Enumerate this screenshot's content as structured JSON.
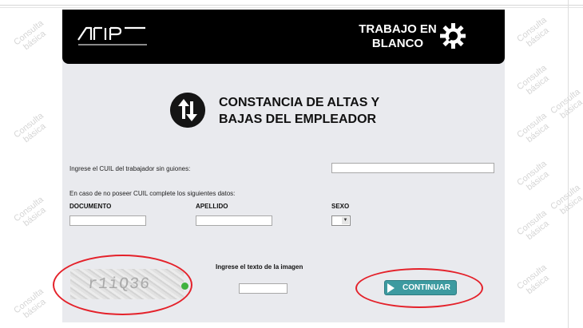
{
  "header": {
    "badge_line1": "TRABAJO EN",
    "badge_line2": "BLANCO"
  },
  "title": {
    "line1": "CONSTANCIA DE ALTAS Y",
    "line2": "BAJAS DEL EMPLEADOR"
  },
  "form": {
    "cuil_label": "Ingrese el CUIL del trabajador sin guiones:",
    "cuil_value": "",
    "alt_label": "En caso de no poseer CUIL complete los siguientes datos:",
    "documento_label": "DOCUMENTO",
    "documento_value": "",
    "apellido_label": "APELLIDO",
    "apellido_value": "",
    "sexo_label": "SEXO",
    "sexo_value": "",
    "captcha_label": "Ingrese el texto de la imagen",
    "captcha_text": "r1iQ36",
    "captcha_value": "",
    "submit_label": "CONTINUAR"
  },
  "watermark": {
    "line1": "Consulta",
    "line2": "básica"
  },
  "colors": {
    "header_bg": "#000000",
    "panel_bg": "#e9eaee",
    "button_bg": "#3d9aa0",
    "highlight": "#e4212a"
  }
}
